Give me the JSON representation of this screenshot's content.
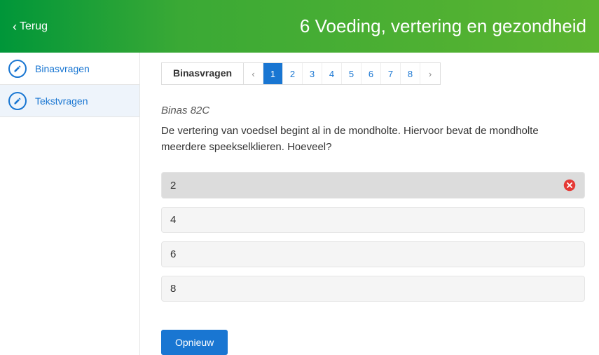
{
  "header": {
    "back_label": "Terug",
    "title": "6 Voeding, vertering en gezondheid"
  },
  "sidebar": {
    "items": [
      {
        "label": "Binasvragen",
        "active": false
      },
      {
        "label": "Tekstvragen",
        "active": true
      }
    ]
  },
  "pager": {
    "label": "Binasvragen",
    "pages": [
      "1",
      "2",
      "3",
      "4",
      "5",
      "6",
      "7",
      "8"
    ],
    "active": "1"
  },
  "question": {
    "source": "Binas 82C",
    "text": "De vertering van voedsel begint al in de mondholte. Hiervoor bevat de mondholte meerdere speekselklieren. Hoeveel?",
    "options": [
      {
        "label": "2",
        "state": "wrong"
      },
      {
        "label": "4",
        "state": "neutral"
      },
      {
        "label": "6",
        "state": "neutral"
      },
      {
        "label": "8",
        "state": "neutral"
      }
    ]
  },
  "actions": {
    "retry": "Opnieuw"
  },
  "colors": {
    "primary": "#1976d2",
    "wrong": "#e53935",
    "header_start": "#009639",
    "header_end": "#5cb531"
  }
}
